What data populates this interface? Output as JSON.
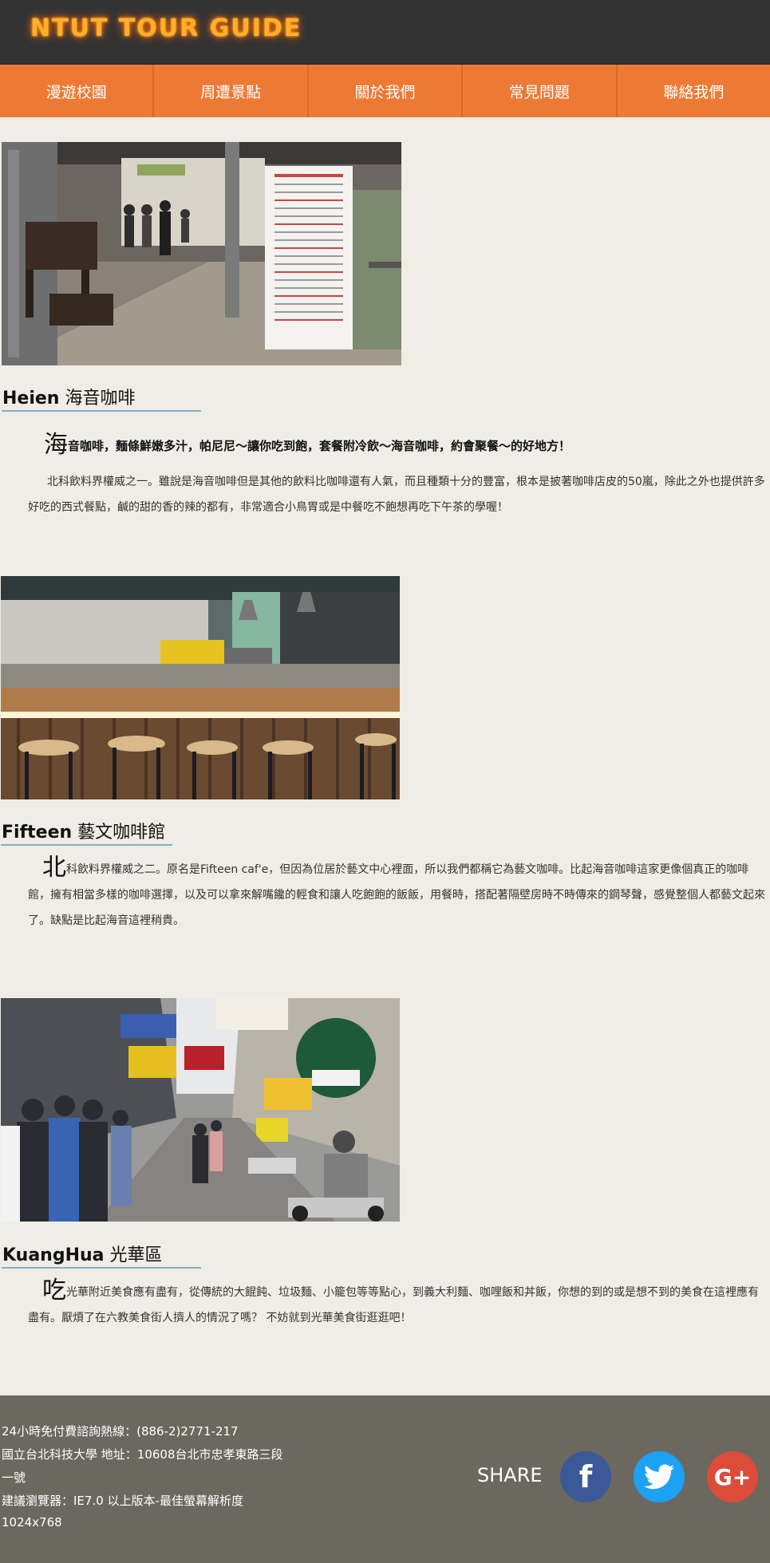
{
  "header": {
    "logo": "NTUT TOUR GUIDE"
  },
  "nav": {
    "items": [
      "漫遊校園",
      "周遭景點",
      "關於我們",
      "常見問題",
      "聯絡我們"
    ]
  },
  "sections": [
    {
      "title_en": "Heien",
      "title_zh": "海音咖啡",
      "lead_first": "海",
      "lead_rest": "音咖啡，麵條鮮嫩多汁，帕尼尼～讓你吃到飽，套餐附冷飲～海音咖啡，約會聚餐～的好地方！",
      "body": "北科飲料界權威之一。雖說是海音咖啡但是其他的飲料比咖啡還有人氣，而且種類十分的豐富，根本是披著咖啡店皮的50嵐，除此之外也提供許多好吃的西式餐點，鹹的甜的香的辣的都有，非常適合小鳥胃或是中餐吃不飽想再吃下午茶的學喔！"
    },
    {
      "title_en": "Fifteen",
      "title_zh": "藝文咖啡館",
      "lead_first": "北",
      "body": "科飲料界權威之二。原名是Fifteen caf'e，但因為位居於藝文中心裡面，所以我們都稱它為藝文咖啡。比起海音咖啡這家更像個真正的咖啡館，擁有相當多樣的咖啡選擇，以及可以拿來解嘴饞的輕食和讓人吃飽飽的飯飯，用餐時，搭配著隔壁房時不時傳來的鋼琴聲，感覺整個人都藝文起來了。缺點是比起海音這裡稍貴。"
    },
    {
      "title_en": "KuangHua",
      "title_zh": "光華區",
      "lead_first": "吃",
      "body": "光華附近美食應有盡有，從傳統的大餛飩、垃圾麵、小籠包等等點心，到義大利麵、咖哩飯和丼飯，你想的到的或是想不到的美食在這裡應有盡有。厭煩了在六教美食街人擠人的情況了嗎？ 不妨就到光華美食街逛逛吧！"
    }
  ],
  "footer": {
    "line1": "24小時免付費諮詢熱線：(886-2)2771-217",
    "line2": "國立台北科技大學 地址：10608台北市忠孝東路三段",
    "line3": "一號",
    "line4": "建議瀏覽器：IE7.0 以上版本-最佳螢幕解析度",
    "line5": "1024x768",
    "share": "SHARE",
    "social": [
      {
        "name": "facebook",
        "glyph": "f",
        "color": "#3b5998"
      },
      {
        "name": "twitter",
        "glyph": "t",
        "color": "#1da1f2"
      },
      {
        "name": "google-plus",
        "glyph": "G+",
        "color": "#dd4b39"
      }
    ]
  }
}
